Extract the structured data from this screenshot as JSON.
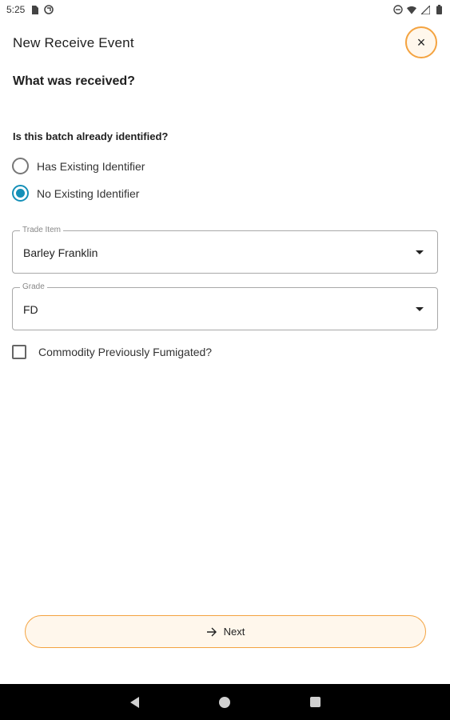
{
  "status_bar": {
    "time": "5:25",
    "left_icons": [
      "sim-card-icon",
      "sync-icon"
    ],
    "right_icons": [
      "do-not-disturb-icon",
      "wifi-icon",
      "cell-signal-icon",
      "battery-icon"
    ]
  },
  "header": {
    "title": "New Receive Event",
    "close_label": "×"
  },
  "section_title": "What was received?",
  "question": "Is this batch already identified?",
  "radios": [
    {
      "label": "Has Existing Identifier",
      "checked": false
    },
    {
      "label": "No Existing Identifier",
      "checked": true
    }
  ],
  "trade_item": {
    "label": "Trade Item",
    "value": "Barley Franklin"
  },
  "grade": {
    "label": "Grade",
    "value": "FD"
  },
  "fumigated": {
    "label": "Commodity Previously Fumigated?",
    "checked": false
  },
  "next_button": {
    "label": "Next"
  },
  "colors": {
    "accent": "#f4a340",
    "accent_bg": "#fff7ec",
    "radio_selected": "#1590b8"
  }
}
